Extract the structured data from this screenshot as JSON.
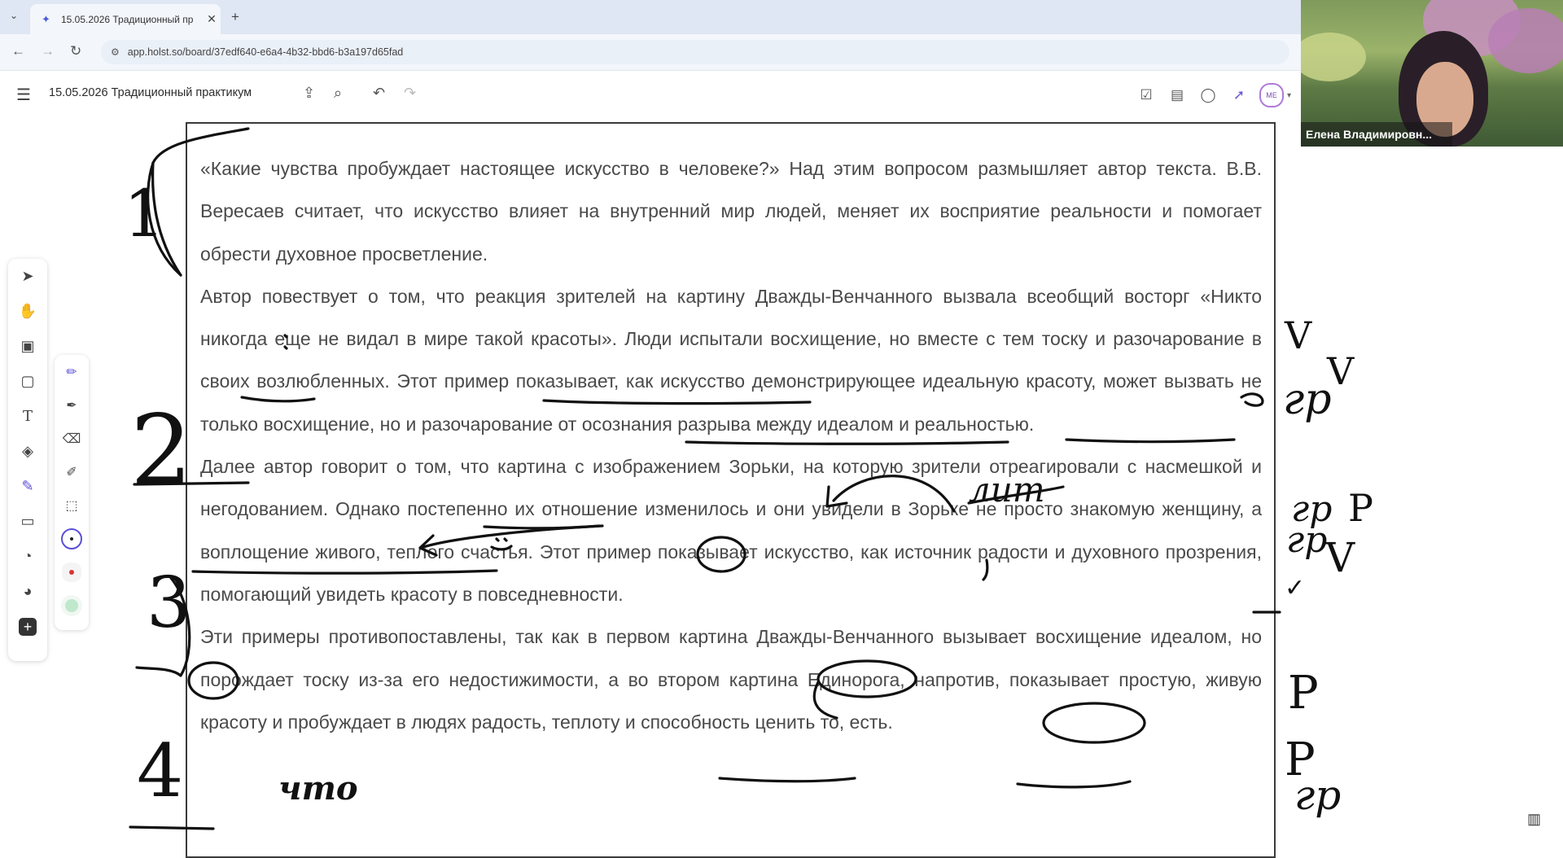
{
  "browser": {
    "tab_title": "15.05.2026 Традиционный пр",
    "url": "app.holst.so/board/37edf640-e6a4-4b32-bbd6-b3a197d65fad"
  },
  "app": {
    "board_title": "15.05.2026 Традиционный практикум",
    "avatar_initials": "ME"
  },
  "video": {
    "participant_name": "Елена Владимировн..."
  },
  "essay": {
    "paragraphs": [
      "«Какие чувства пробуждает настоящее искусство в человеке?» Над этим вопросом размышляет автор текста. В.В. Вересаев считает, что искусство влияет на внутренний мир людей, меняет их восприятие реальности и помогает обрести духовное просветление.",
      "Автор повествует о том, что реакция зрителей на картину Дважды-Венчанного вызвала всеобщий восторг «Никто никогда еще не видал в мире такой красоты». Люди испытали восхищение, но вместе с тем тоску и разочарование в своих возлюбленных. Этот пример показывает, как искусство демонстрирующее идеальную красоту, может вызвать не только восхищение, но и разочарование от осознания разрыва между идеалом и реальностью.",
      "Далее автор говорит о том, что картина с изображением Зорьки, на которую зрители отреагировали с насмешкой и негодованием. Однако постепенно их отношение изменилось и они увидели в Зорьке не просто знакомую женщину, а воплощение живого, теплого счастья. Этот пример показывает искусство, как источник радости и духовного прозрения, помогающий увидеть красоту в повседневности.",
      "Эти примеры противопоставлены, так как в первом картина Дважды-Венчанного вызывает восхищение идеалом, но порождает тоску из-за его недостижимости, а во втором картина Единорога, напротив, показывает простую, живую красоту и пробуждает в людях радость, теплоту и способность ценить то, есть."
    ]
  },
  "annotations": {
    "margin_numbers": [
      "1",
      "2",
      "3",
      "4"
    ],
    "marks": [
      "V",
      "V",
      "V",
      "✓",
      "гр",
      "гр",
      "гр",
      "гр",
      "Р",
      "Р",
      "Р"
    ],
    "inserted_words": [
      "лит",
      "что"
    ]
  },
  "colors": {
    "accent": "#5b4fd6",
    "frame": "#3a3a3a",
    "ink": "#111111"
  },
  "icons": {
    "toolbar": [
      "cursor-icon",
      "hand-icon",
      "frame-icon",
      "sticky-note-icon",
      "text-icon",
      "shapes-icon",
      "pen-icon",
      "card-icon",
      "comment-icon",
      "palette-icon",
      "plus-icon"
    ],
    "pen_tools": [
      "pencil-icon",
      "marker-icon",
      "eraser-icon",
      "lasso-icon",
      "select-region-icon"
    ]
  }
}
